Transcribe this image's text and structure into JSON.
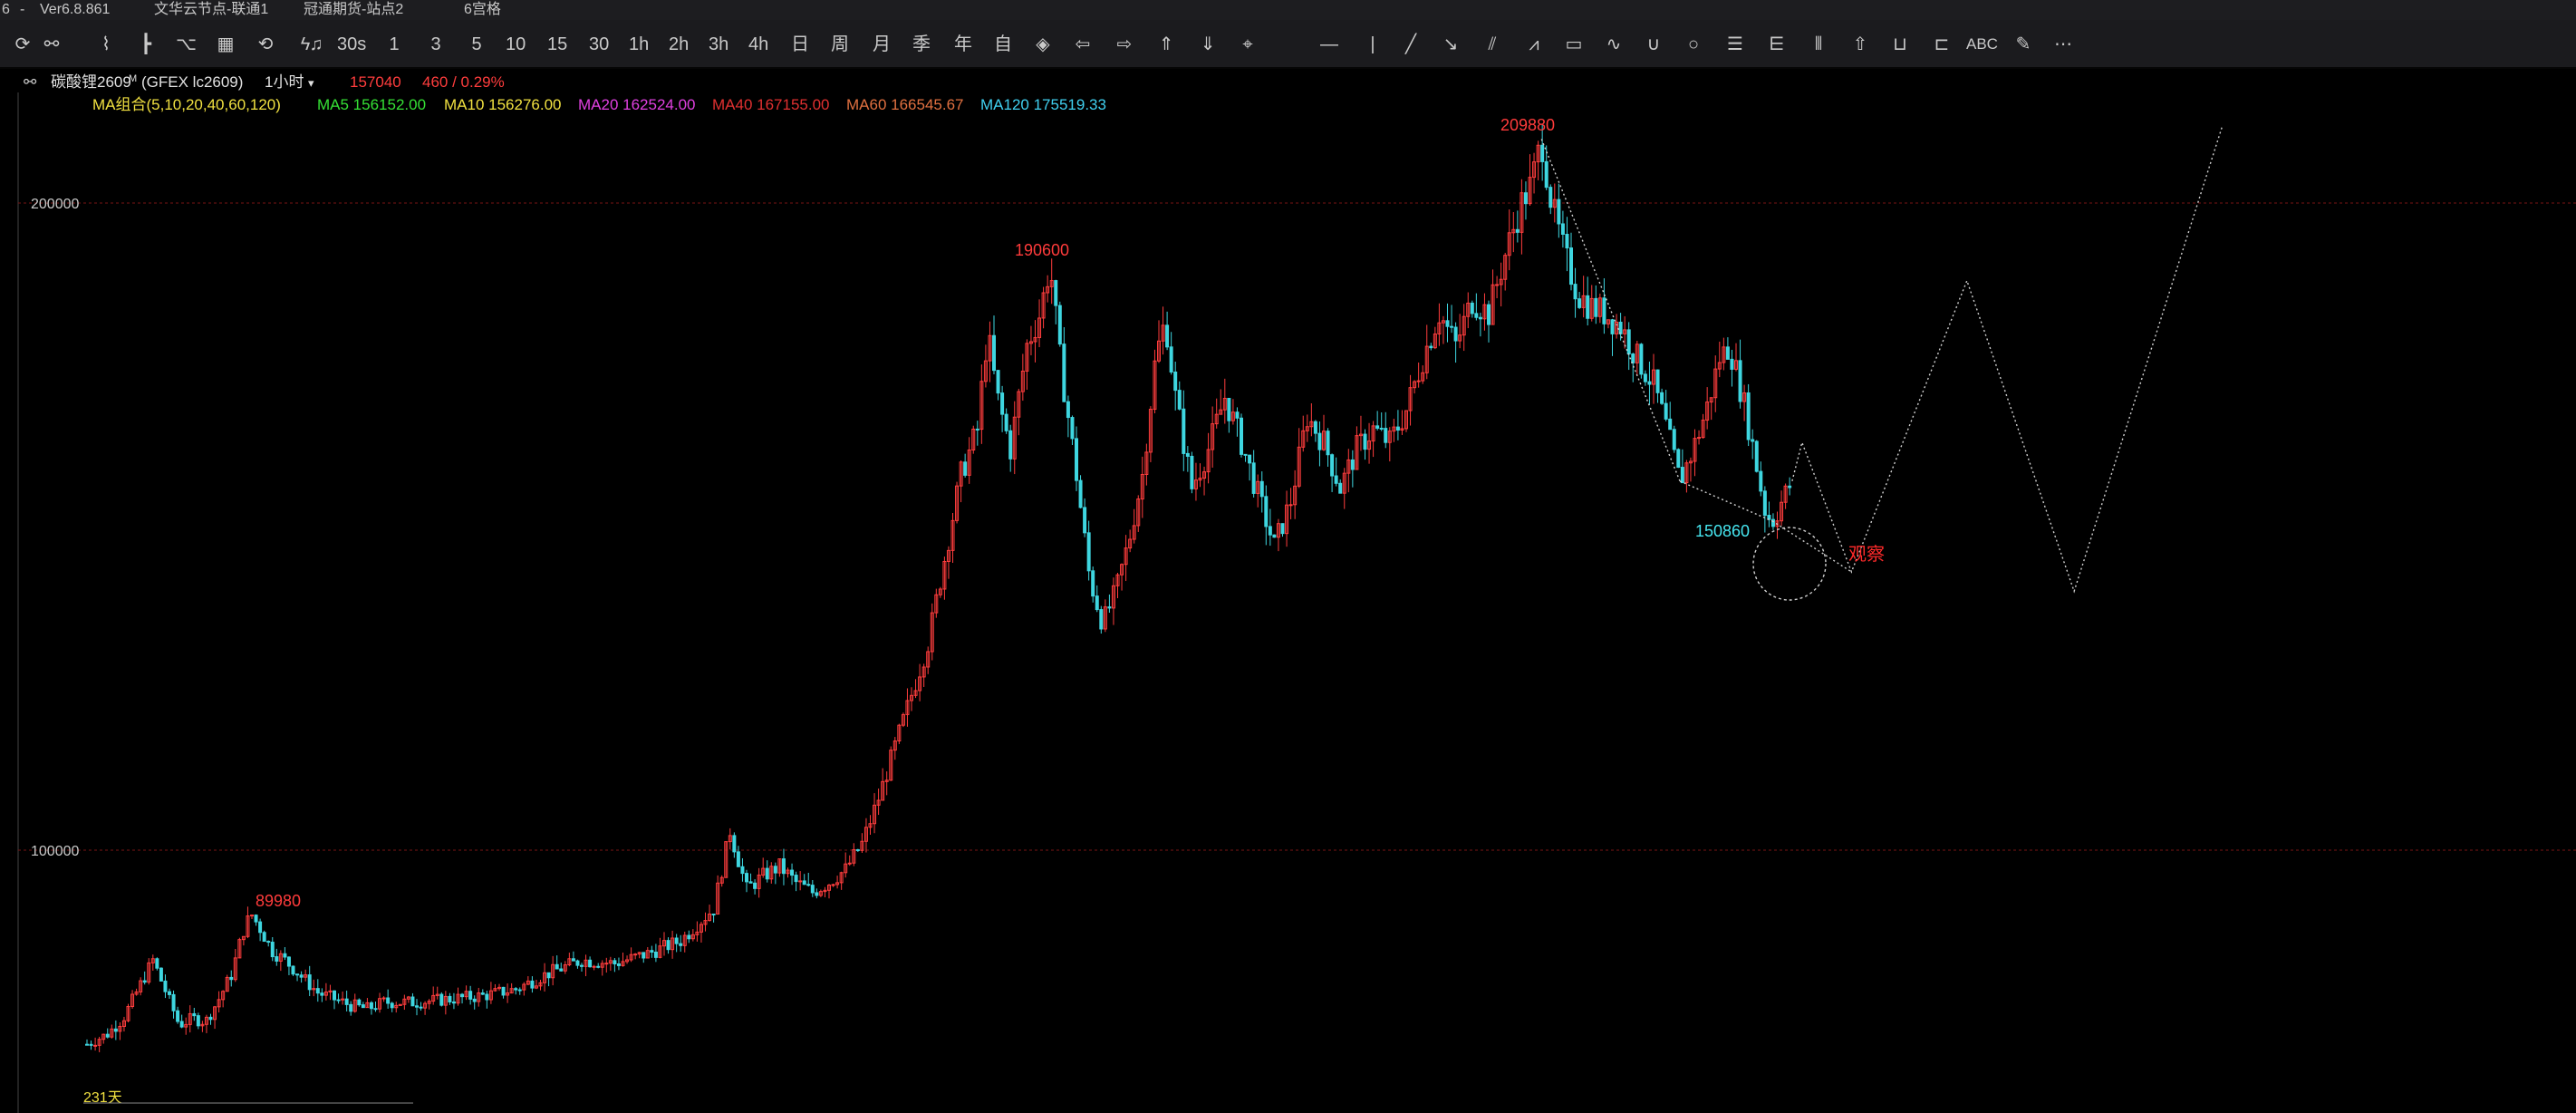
{
  "window": {
    "left_mark": "6",
    "separator": "-",
    "version": "Ver6.8.861",
    "server1": "文华云节点-联通1",
    "server2": "冠通期货-站点2",
    "grid_mode": "6宫格"
  },
  "toolbar": {
    "periods": [
      "30s",
      "1",
      "3",
      "5",
      "10",
      "15",
      "30",
      "1h",
      "2h",
      "3h",
      "4h",
      "日",
      "周",
      "月",
      "季",
      "年",
      "自"
    ],
    "tools_right": [
      "ABC"
    ]
  },
  "header": {
    "symbol": "碳酸锂2609",
    "symbol_sup": "M",
    "code": "(GFEX lc2609)",
    "period": "1小时",
    "price": "157040",
    "change": "460 / 0.29%"
  },
  "ma": {
    "group": "MA组合(5,10,20,40,60,120)",
    "items": [
      {
        "label": "MA5 156152.00",
        "color": "#35e035"
      },
      {
        "label": "MA10 156276.00",
        "color": "#f0e040"
      },
      {
        "label": "MA20 162524.00",
        "color": "#e040e0"
      },
      {
        "label": "MA40 167155.00",
        "color": "#e03030"
      },
      {
        "label": "MA60 166545.67",
        "color": "#e07040"
      },
      {
        "label": "MA120 175519.33",
        "color": "#40d0f0"
      }
    ]
  },
  "chart_data": {
    "type": "candlestick",
    "y_axis_labels": [
      "200000",
      "100000"
    ],
    "y_axis_values": [
      200000,
      100000
    ],
    "annotations": [
      {
        "text": "89980",
        "value": 89980,
        "kind": "high"
      },
      {
        "text": "190600",
        "value": 190600,
        "kind": "high"
      },
      {
        "text": "209880",
        "value": 209880,
        "kind": "high"
      },
      {
        "text": "150860",
        "value": 150860,
        "kind": "low"
      },
      {
        "text": "观察",
        "kind": "note"
      }
    ],
    "bottom_label": "231天",
    "price_path": [
      [
        0,
        70000
      ],
      [
        12,
        71500
      ],
      [
        22,
        74000
      ],
      [
        32,
        79000
      ],
      [
        40,
        83000
      ],
      [
        48,
        78000
      ],
      [
        56,
        73000
      ],
      [
        64,
        74000
      ],
      [
        72,
        73500
      ],
      [
        80,
        77000
      ],
      [
        88,
        81000
      ],
      [
        92,
        85000
      ],
      [
        96,
        88500
      ],
      [
        100,
        89980
      ],
      [
        106,
        87500
      ],
      [
        112,
        84500
      ],
      [
        120,
        83000
      ],
      [
        130,
        80500
      ],
      [
        140,
        78000
      ],
      [
        150,
        77000
      ],
      [
        160,
        76000
      ],
      [
        170,
        75500
      ],
      [
        180,
        76500
      ],
      [
        200,
        76500
      ],
      [
        220,
        77000
      ],
      [
        240,
        77500
      ],
      [
        260,
        78500
      ],
      [
        280,
        81000
      ],
      [
        300,
        83000
      ],
      [
        320,
        82500
      ],
      [
        340,
        84000
      ],
      [
        360,
        86000
      ],
      [
        380,
        91000
      ],
      [
        390,
        103000
      ],
      [
        400,
        94000
      ],
      [
        410,
        96000
      ],
      [
        420,
        97500
      ],
      [
        430,
        95000
      ],
      [
        440,
        93500
      ],
      [
        450,
        95000
      ],
      [
        460,
        97000
      ],
      [
        470,
        101000
      ],
      [
        480,
        108000
      ],
      [
        490,
        116000
      ],
      [
        500,
        124000
      ],
      [
        510,
        132000
      ],
      [
        520,
        145000
      ],
      [
        530,
        158000
      ],
      [
        540,
        165000
      ],
      [
        546,
        180000
      ],
      [
        552,
        170000
      ],
      [
        560,
        162000
      ],
      [
        570,
        178000
      ],
      [
        578,
        183000
      ],
      [
        584,
        190600
      ],
      [
        590,
        176000
      ],
      [
        600,
        158000
      ],
      [
        608,
        142000
      ],
      [
        616,
        135000
      ],
      [
        624,
        140000
      ],
      [
        632,
        148000
      ],
      [
        640,
        158000
      ],
      [
        648,
        176000
      ],
      [
        654,
        182000
      ],
      [
        660,
        170000
      ],
      [
        670,
        156000
      ],
      [
        680,
        162000
      ],
      [
        690,
        170000
      ],
      [
        700,
        163000
      ],
      [
        710,
        155000
      ],
      [
        720,
        147000
      ],
      [
        730,
        154000
      ],
      [
        740,
        167000
      ],
      [
        750,
        163000
      ],
      [
        760,
        156000
      ],
      [
        770,
        162000
      ],
      [
        780,
        165000
      ],
      [
        790,
        163000
      ],
      [
        800,
        168000
      ],
      [
        810,
        176000
      ],
      [
        820,
        183000
      ],
      [
        830,
        178000
      ],
      [
        840,
        185000
      ],
      [
        850,
        183000
      ],
      [
        860,
        192000
      ],
      [
        870,
        200000
      ],
      [
        876,
        203000
      ],
      [
        882,
        209880
      ],
      [
        888,
        200000
      ],
      [
        896,
        192000
      ],
      [
        904,
        186000
      ],
      [
        912,
        184000
      ],
      [
        920,
        183000
      ],
      [
        930,
        181000
      ],
      [
        940,
        176000
      ],
      [
        950,
        172000
      ],
      [
        958,
        165000
      ],
      [
        966,
        157000
      ],
      [
        974,
        162000
      ],
      [
        982,
        168000
      ],
      [
        990,
        176000
      ],
      [
        996,
        178000
      ],
      [
        1004,
        170000
      ],
      [
        1012,
        160000
      ],
      [
        1018,
        152000
      ],
      [
        1022,
        150860
      ],
      [
        1028,
        154000
      ],
      [
        1034,
        157040
      ]
    ],
    "forecast_path": [
      [
        1034,
        157040
      ],
      [
        1040,
        163000
      ],
      [
        1070,
        143000
      ],
      [
        1140,
        188000
      ],
      [
        1205,
        140000
      ],
      [
        1295,
        212000
      ]
    ],
    "wedge_lines": [
      [
        [
          882,
          209880
        ],
        [
          966,
          157000
        ]
      ],
      [
        [
          966,
          157000
        ],
        [
          1022,
          150860
        ]
      ],
      [
        [
          1022,
          150860
        ],
        [
          1070,
          143000
        ]
      ]
    ]
  },
  "colors": {
    "up": "#ff3d3d",
    "down": "#3ed6e0",
    "grid": "#7a1515",
    "dotted": "#d0d0d0"
  }
}
